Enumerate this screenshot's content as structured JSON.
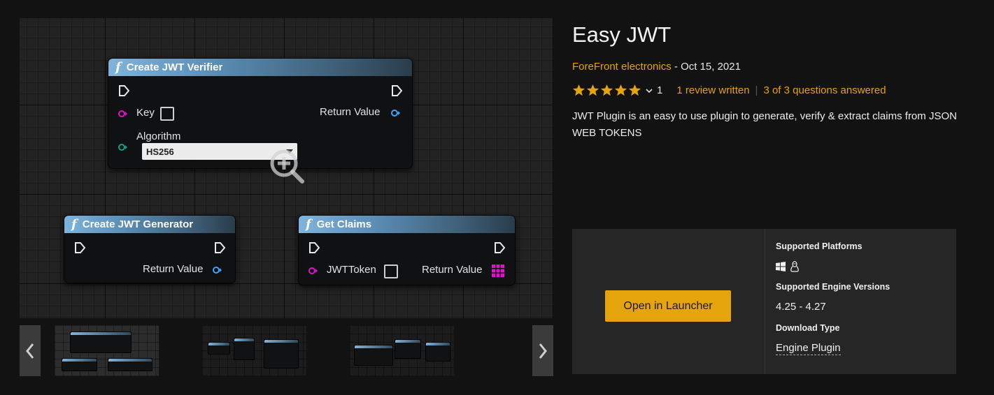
{
  "gallery": {
    "nodes": {
      "verifier": {
        "title": "Create JWT Verifier",
        "key_label": "Key",
        "return_label": "Return Value",
        "algorithm_label": "Algorithm",
        "algorithm_value": "HS256"
      },
      "generator": {
        "title": "Create JWT Generator",
        "return_label": "Return Value"
      },
      "claims": {
        "title": "Get Claims",
        "token_label": "JWTToken",
        "return_label": "Return Value"
      }
    },
    "icons": {
      "zoom": "zoom-in-icon",
      "prev": "chevron-left-icon",
      "next": "chevron-right-icon"
    },
    "thumbnail_count": 3,
    "active_thumbnail": 1
  },
  "product": {
    "title": "Easy JWT",
    "seller": "ForeFront electronics",
    "byline_separator": " - ",
    "date": "Oct 15, 2021",
    "rating_stars": 5,
    "rating_count": "1",
    "reviews": "1 review written",
    "separator": "|",
    "questions": "3 of 3 questions answered",
    "description": "JWT Plugin is an easy to use plugin to generate, verify & extract claims from JSON WEB TOKENS"
  },
  "panel": {
    "button_label": "Open in Launcher",
    "platforms_label": "Supported Platforms",
    "platform_icons": [
      "windows-icon",
      "linux-icon"
    ],
    "engine_label": "Supported Engine Versions",
    "engine_versions": "4.25 - 4.27",
    "download_label": "Download Type",
    "download_type": "Engine Plugin"
  },
  "colors": {
    "accent": "#e6a40c",
    "link": "#e8a200",
    "background": "#121212",
    "panel": "#262626",
    "pin_magenta": "#e10fd0",
    "pin_teal": "#0fa28b",
    "pin_blue": "#3fa6ff"
  }
}
